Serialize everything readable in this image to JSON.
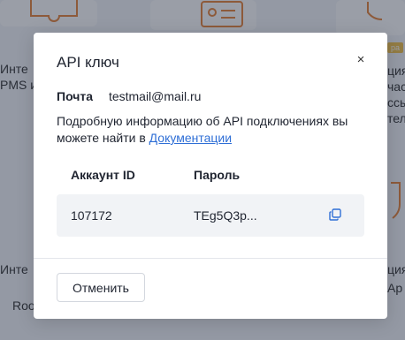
{
  "background": {
    "left_texts": [
      "Инте",
      "PMS и",
      "Инте",
      "Roo"
    ],
    "right_texts": [
      "ция",
      "час",
      "ссыл",
      "тель",
      "ция",
      "Ар"
    ],
    "badge": "ра"
  },
  "modal": {
    "title": "API ключ",
    "close_icon": "×",
    "email_label": "Почта",
    "email_value": "testmail@mail.ru",
    "info_text": "Подробную информацию об API подключениях вы можете найти в",
    "docs_link": "Документации",
    "table": {
      "headers": [
        "Аккаунт ID",
        "Пароль"
      ],
      "row": {
        "account_id": "107172",
        "password": "TEg5Q3p..."
      }
    },
    "cancel_label": "Отменить"
  },
  "colors": {
    "link": "#2f6fd6",
    "overlay": "rgba(30,40,60,0.45)",
    "accent_badge": "#f3c24a"
  }
}
